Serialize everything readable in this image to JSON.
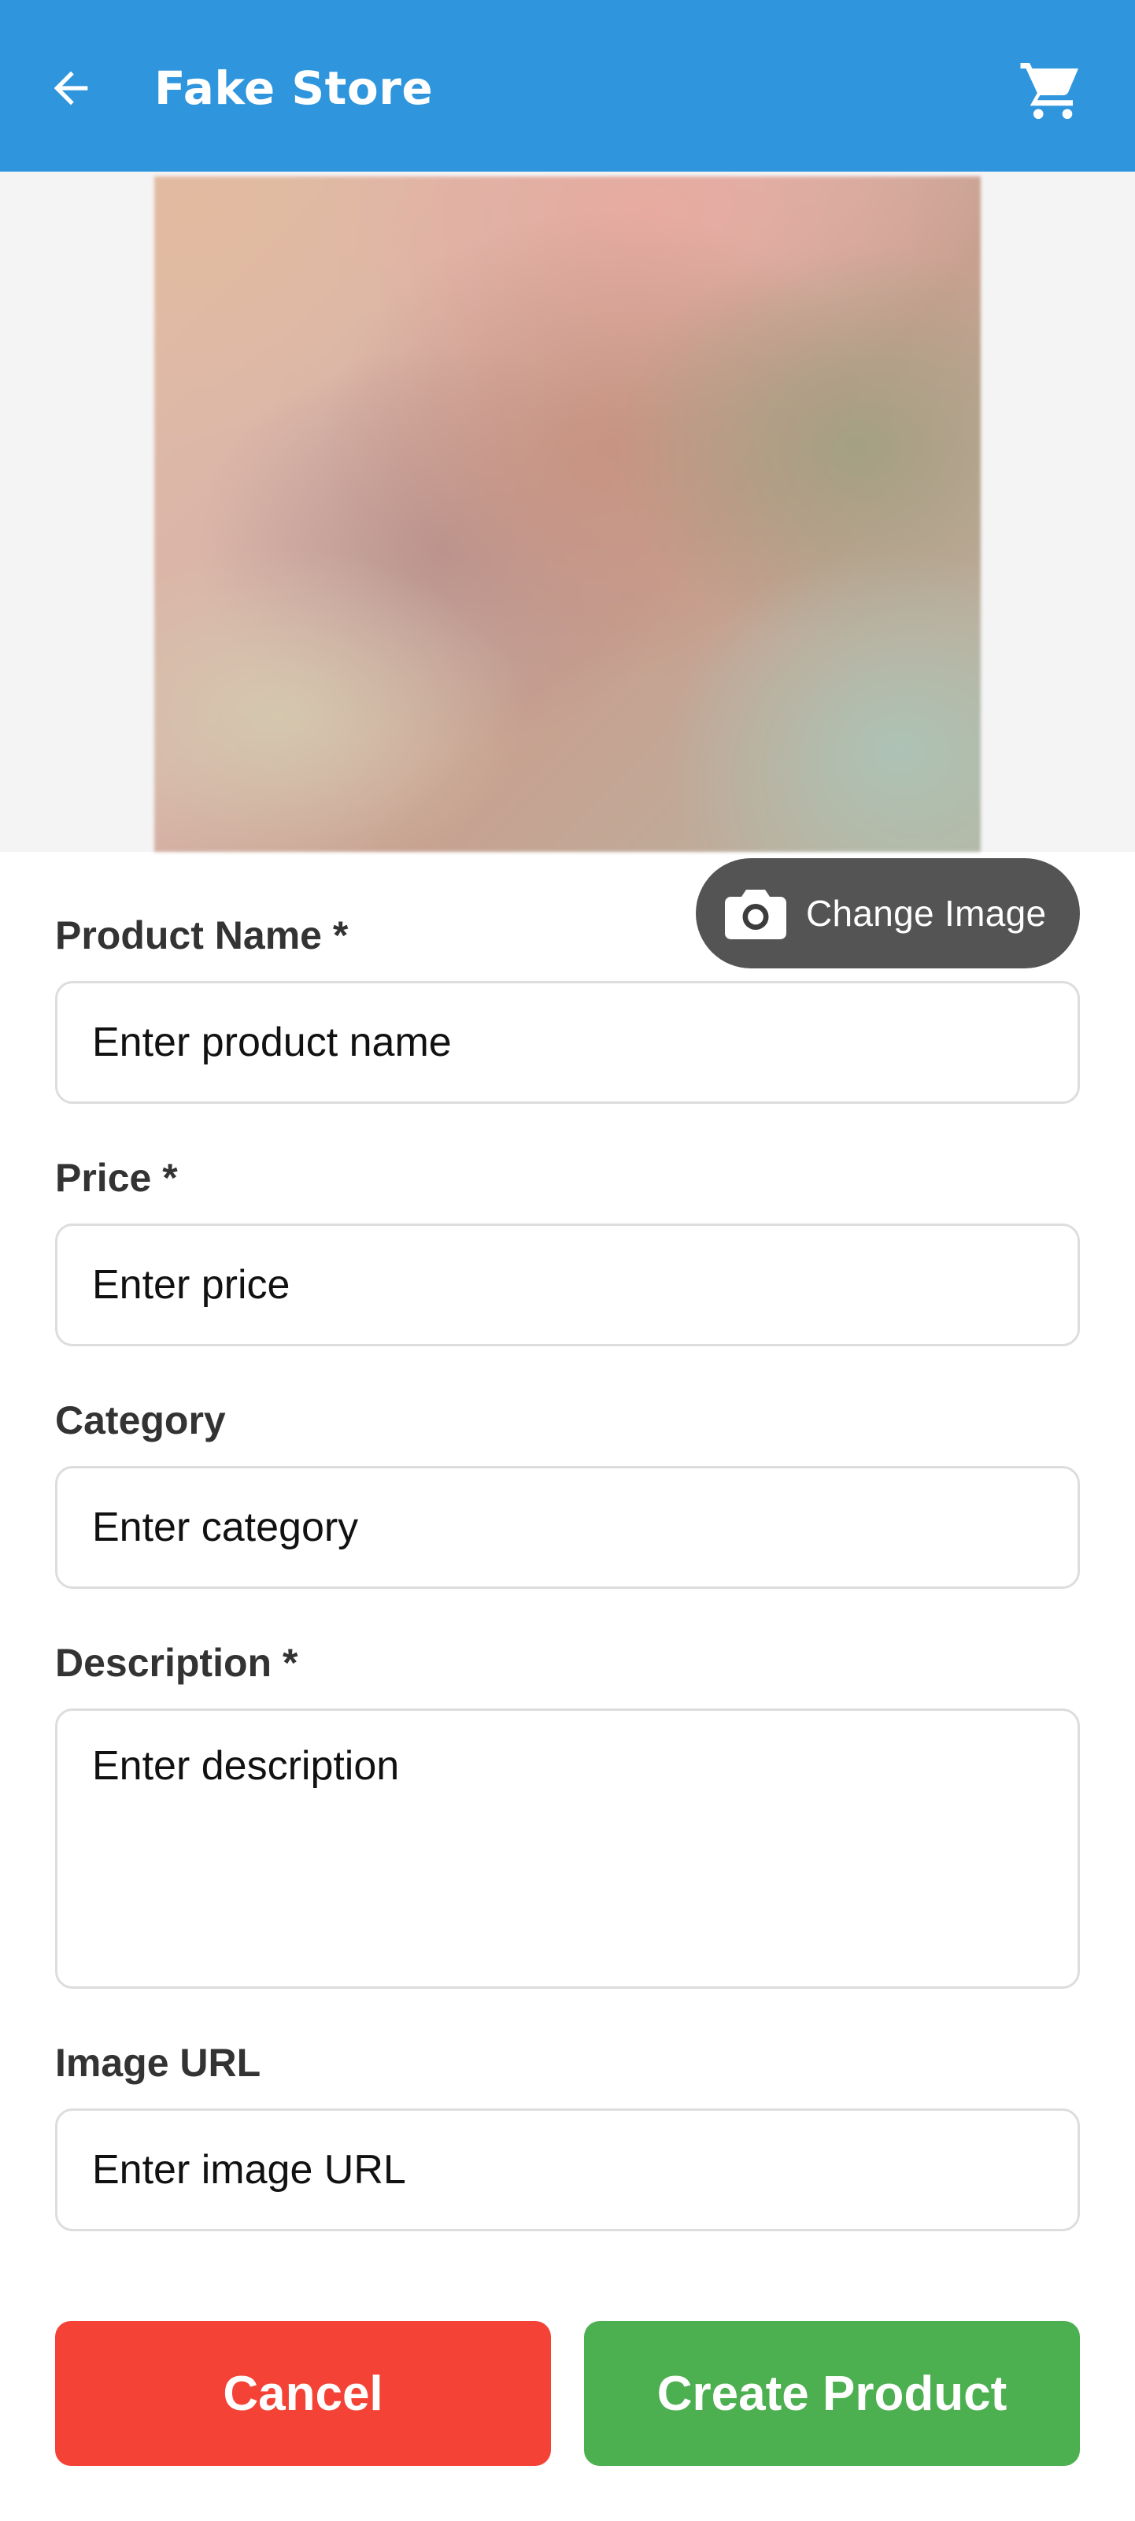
{
  "app_bar": {
    "title": "Fake Store",
    "back_icon": "arrow-left-icon",
    "cart_icon": "shopping-cart-icon",
    "background_color": "#2f96dd"
  },
  "image_section": {
    "change_image_label": "Change Image",
    "camera_icon": "camera-icon"
  },
  "form": {
    "product_name": {
      "label": "Product Name *",
      "placeholder": "Enter product name"
    },
    "price": {
      "label": "Price *",
      "placeholder": "Enter price"
    },
    "category": {
      "label": "Category",
      "placeholder": "Enter category"
    },
    "description": {
      "label": "Description *",
      "placeholder": "Enter description"
    },
    "image_url": {
      "label": "Image URL",
      "placeholder": "Enter image URL"
    }
  },
  "actions": {
    "cancel_label": "Cancel",
    "create_label": "Create Product",
    "cancel_color": "#f44336",
    "create_color": "#4caf50"
  }
}
